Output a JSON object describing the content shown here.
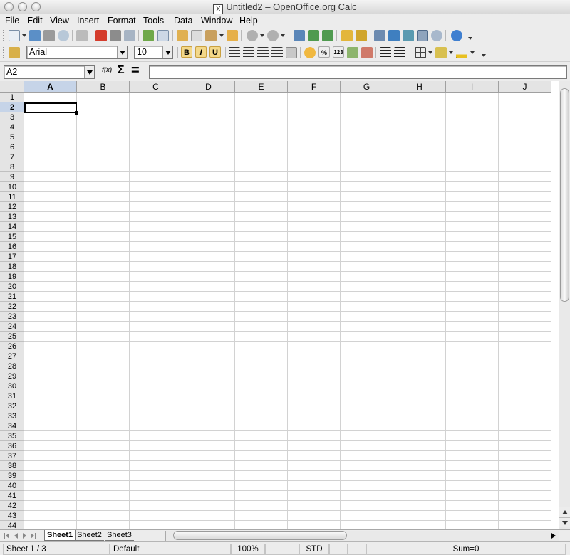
{
  "window": {
    "title": "Untitled2 – OpenOffice.org Calc",
    "app_icon_glyph": "X"
  },
  "menu": [
    {
      "label": "File"
    },
    {
      "label": "Edit"
    },
    {
      "label": "View"
    },
    {
      "label": "Insert"
    },
    {
      "label": "Format"
    },
    {
      "label": "Tools"
    },
    {
      "label": "Data"
    },
    {
      "label": "Window"
    },
    {
      "label": "Help"
    }
  ],
  "toolbar_formatting": {
    "font_name": "Arial",
    "font_size": "10",
    "bold_glyph": "B",
    "italic_glyph": "I",
    "underline_glyph": "U",
    "percent_glyph": "%",
    "number_glyph": "123"
  },
  "formula_bar": {
    "name_box": "A2",
    "function_wizard_glyph": "f(x)",
    "sum_glyph": "Σ",
    "equals_glyph": "=",
    "content": ""
  },
  "grid": {
    "columns": [
      "A",
      "B",
      "C",
      "D",
      "E",
      "F",
      "G",
      "H",
      "I",
      "J"
    ],
    "rows": [
      "1",
      "2",
      "3",
      "4",
      "5",
      "6",
      "7",
      "8",
      "9",
      "10",
      "11",
      "12",
      "13",
      "14",
      "15",
      "16",
      "17",
      "18",
      "19",
      "20",
      "21",
      "22",
      "23",
      "24",
      "25",
      "26",
      "27",
      "28",
      "29",
      "30",
      "31",
      "32",
      "33",
      "34",
      "35",
      "36",
      "37",
      "38",
      "39",
      "40",
      "41",
      "42",
      "43",
      "44"
    ],
    "active_column": "A",
    "active_row": "2"
  },
  "sheet_tabs": [
    {
      "label": "Sheet1",
      "active": true
    },
    {
      "label": "Sheet2",
      "active": false
    },
    {
      "label": "Sheet3",
      "active": false
    }
  ],
  "status_bar": {
    "sheet_position": "Sheet 1 / 3",
    "page_style": "Default",
    "zoom": "100%",
    "selection_mode": "STD",
    "sum": "Sum=0"
  },
  "colors": {
    "active_header": "#c6d4e8",
    "gridline": "#d2d2d2",
    "chrome": "#ececec"
  }
}
